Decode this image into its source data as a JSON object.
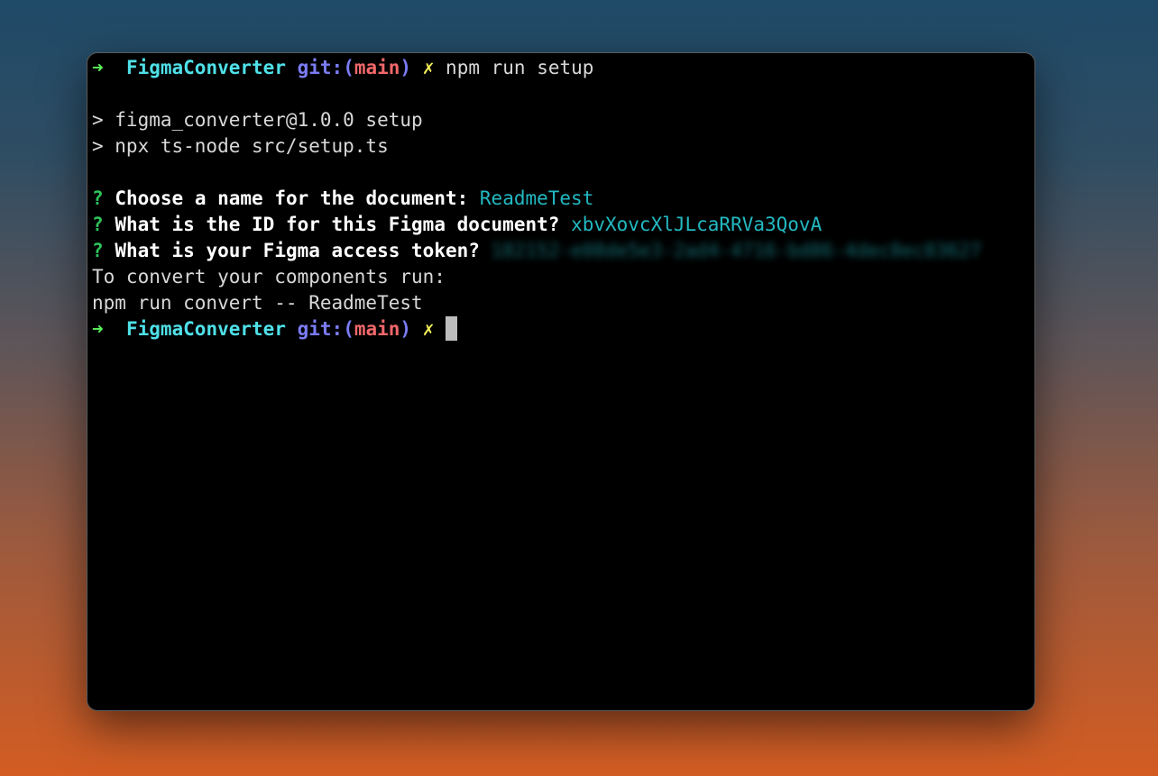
{
  "terminal": {
    "prompt": {
      "arrow": "➜",
      "directory": "FigmaConverter",
      "git_label": "git:(",
      "branch": "main",
      "git_close": ")",
      "dirty_mark": "✗"
    },
    "lines": [
      {
        "command": "npm run setup"
      },
      {
        "text": ""
      },
      {
        "text": "> figma_converter@1.0.0 setup"
      },
      {
        "text": "> npx ts-node src/setup.ts"
      },
      {
        "text": ""
      },
      {
        "question_mark": "?",
        "question": "Choose a name for the document:",
        "answer": "ReadmeTest"
      },
      {
        "question_mark": "?",
        "question": "What is the ID for this Figma document?",
        "answer": "xbvXovcXlJLcaRRVa3QovA"
      },
      {
        "question_mark": "?",
        "question": "What is your Figma access token?",
        "answer": "182152-e08de5e3-2ad4-4716-bd86-4dec8ec83627"
      },
      {
        "text": "To convert your components run:"
      },
      {
        "text": "npm run convert -- ReadmeTest"
      }
    ]
  },
  "colors": {
    "terminal_bg": "#000000",
    "prompt_arrow": "#5af35a",
    "directory": "#4fe0e8",
    "git": "#7b7cf5",
    "branch": "#f2686a",
    "dirty": "#f4f05a",
    "answer": "#23b9c2"
  }
}
